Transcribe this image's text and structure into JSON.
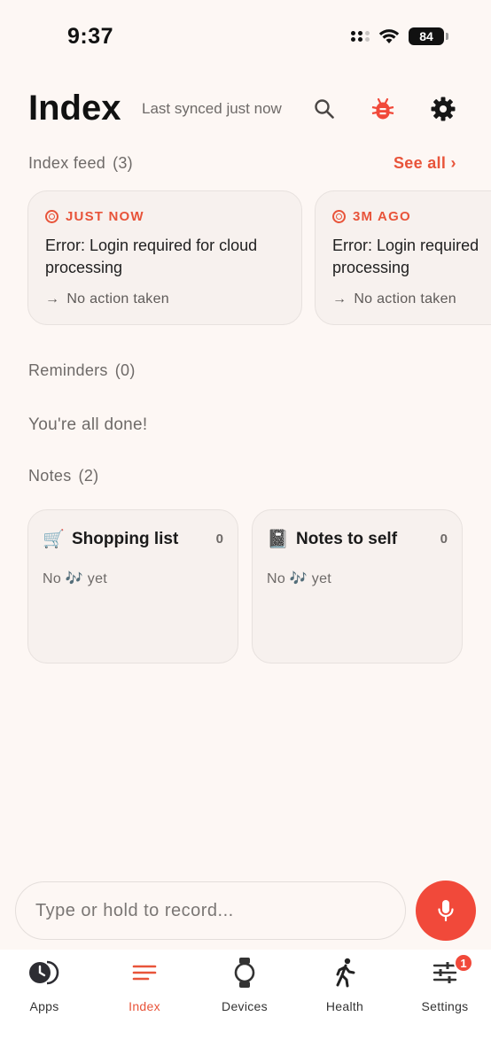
{
  "status_bar": {
    "time": "9:37",
    "battery": "84"
  },
  "header": {
    "title": "Index",
    "sync_status": "Last synced just now"
  },
  "feed": {
    "label": "Index feed",
    "count": "(3)",
    "see_all": "See all ›",
    "items": [
      {
        "time": "JUST NOW",
        "text_line1": "Error: Login required for cloud",
        "text_line2": "processing",
        "action": "No action taken"
      },
      {
        "time": "3M AGO",
        "text_line1": "Error: Login required",
        "text_line2": "processing",
        "action": "No action taken"
      }
    ]
  },
  "reminders": {
    "label": "Reminders",
    "count": "(0)",
    "empty_text": "You're all done!"
  },
  "notes": {
    "label": "Notes",
    "count": "(2)",
    "items": [
      {
        "emoji": "🛒",
        "title": "Shopping list",
        "count": "0",
        "empty_text": "No 🎶 yet"
      },
      {
        "emoji": "📓",
        "title": "Notes to self",
        "count": "0",
        "empty_text": "No 🎶 yet"
      }
    ]
  },
  "composer": {
    "placeholder": "Type or hold to record..."
  },
  "nav": {
    "items": [
      {
        "label": "Apps"
      },
      {
        "label": "Index"
      },
      {
        "label": "Devices"
      },
      {
        "label": "Health"
      },
      {
        "label": "Settings",
        "badge": "1"
      }
    ]
  },
  "colors": {
    "accent": "#e8543a",
    "mic": "#f1493a",
    "background": "#fdf7f4",
    "card": "#f7f1ee"
  }
}
